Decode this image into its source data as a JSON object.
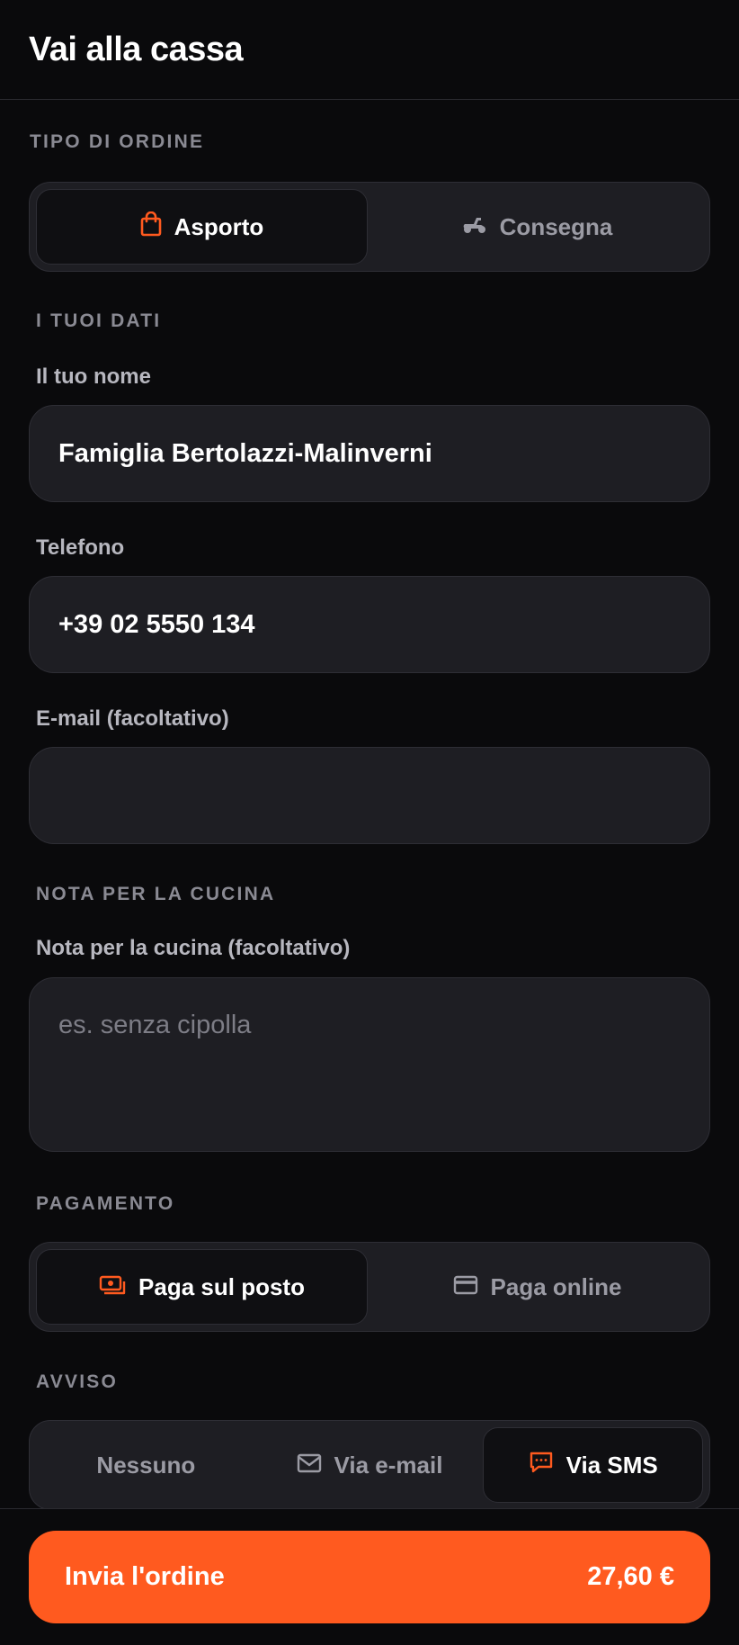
{
  "header": {
    "title": "Vai alla cassa"
  },
  "order_type": {
    "section_label": "TIPO DI ORDINE",
    "options": [
      {
        "label": "Asporto",
        "icon": "shopping-bag-icon",
        "active": true
      },
      {
        "label": "Consegna",
        "icon": "scooter-icon",
        "active": false
      }
    ]
  },
  "your_data": {
    "section_label": "I TUOI DATI",
    "name": {
      "label": "Il tuo nome",
      "value": "Famiglia Bertolazzi-Malinverni"
    },
    "phone": {
      "label": "Telefono",
      "value": "+39 02 5550 134"
    },
    "email": {
      "label": "E-mail (facoltativo)",
      "value": ""
    }
  },
  "kitchen_note": {
    "section_label": "NOTA PER LA CUCINA",
    "label": "Nota per la cucina (facoltativo)",
    "placeholder": "es. senza cipolla"
  },
  "payment": {
    "section_label": "PAGAMENTO",
    "options": [
      {
        "label": "Paga sul posto",
        "icon": "cash-icon",
        "active": true
      },
      {
        "label": "Paga online",
        "icon": "credit-card-icon",
        "active": false
      }
    ]
  },
  "notification": {
    "section_label": "AVVISO",
    "options": [
      {
        "label": "Nessuno",
        "active": false
      },
      {
        "label": "Via e-mail",
        "icon": "mail-icon",
        "active": false
      },
      {
        "label": "Via SMS",
        "icon": "chat-icon",
        "active": true
      }
    ]
  },
  "footer": {
    "submit_label": "Invia l'ordine",
    "total": "27,60 €"
  },
  "colors": {
    "accent": "#ff5a1f",
    "background": "#0a0a0c",
    "surface": "#1e1e23",
    "border": "#2e2e35",
    "muted_text": "#8a8a93"
  }
}
